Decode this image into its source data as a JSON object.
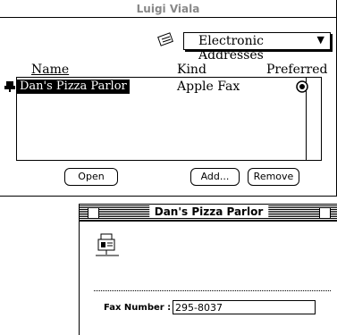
{
  "window": {
    "title": "Luigi Viala"
  },
  "popup": {
    "selected": "Electronic Addresses"
  },
  "columns": {
    "name": "Name",
    "kind": "Kind",
    "preferred": "Preferred"
  },
  "rows": [
    {
      "name": "Dan's Pizza Parlor",
      "kind": "Apple Fax",
      "preferred": true
    }
  ],
  "buttons": {
    "open": "Open",
    "add": "Add...",
    "remove": "Remove"
  },
  "detail": {
    "title": "Dan's Pizza Parlor",
    "fax_label": "Fax Number :",
    "fax_value": "295-8037"
  },
  "icons": {
    "popup": "card-icon",
    "row": "fax-icon",
    "detail": "fax-machine-icon"
  }
}
